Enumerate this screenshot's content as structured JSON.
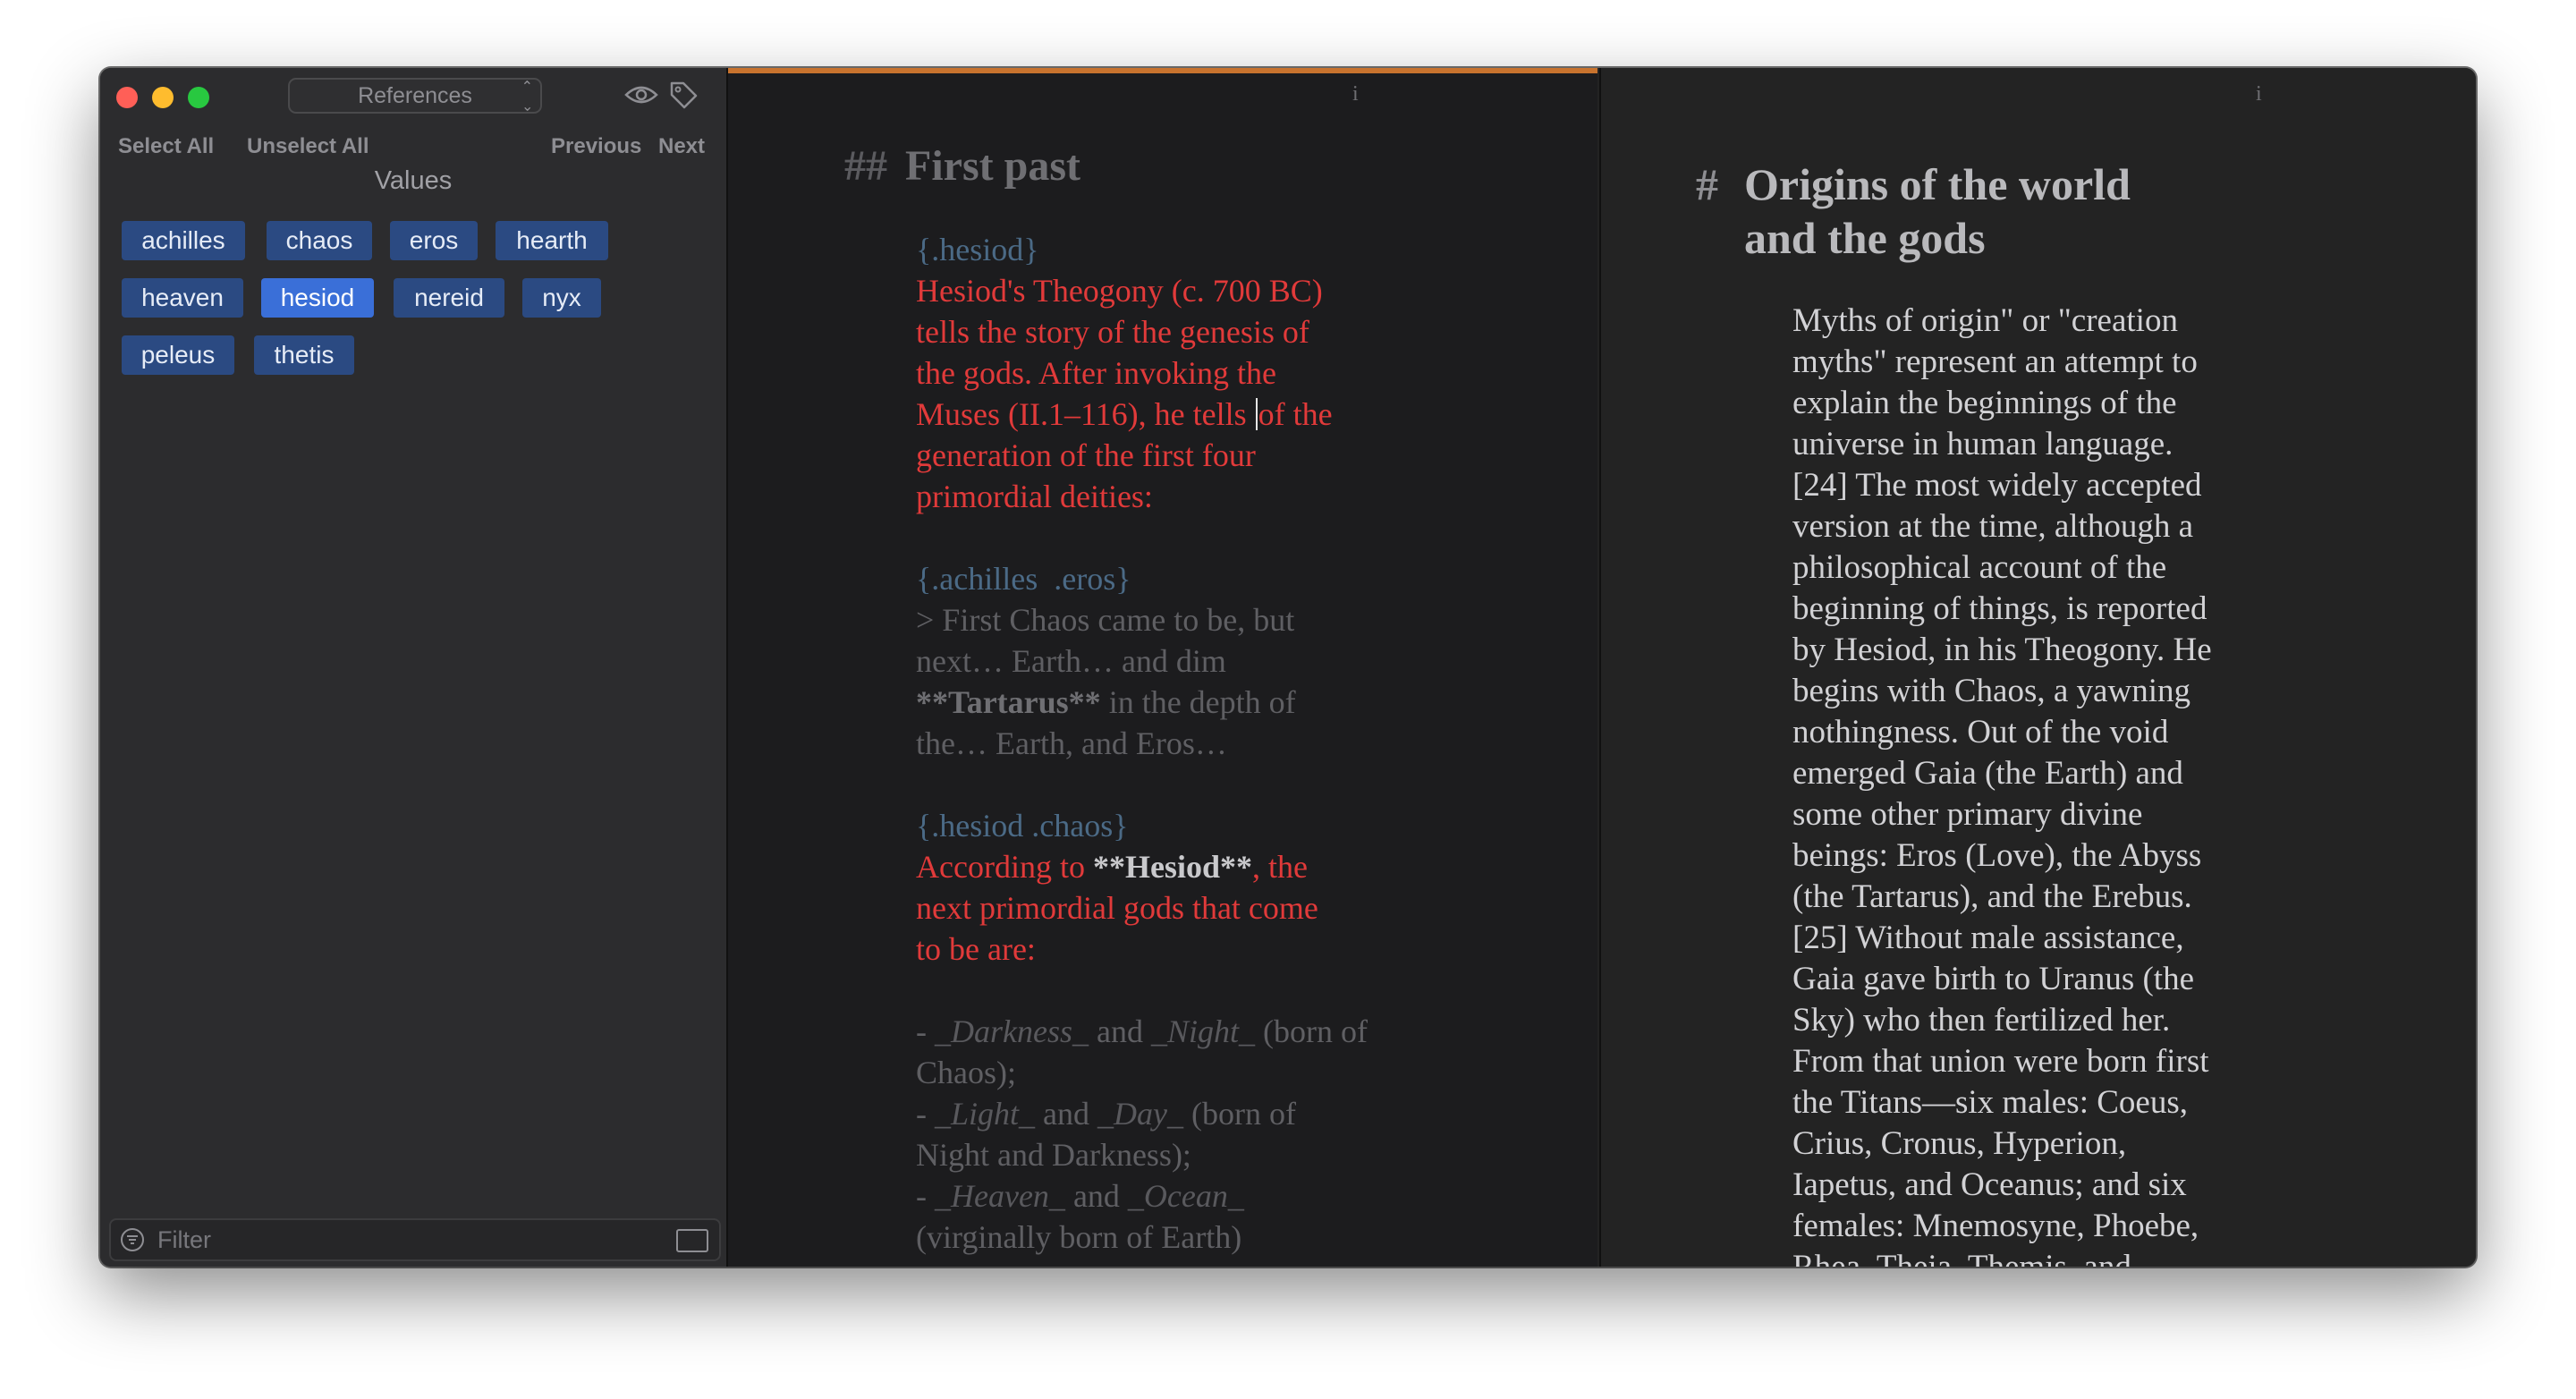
{
  "sidebar": {
    "popup_label": "References",
    "popup_icon": "chevron-updown-icon",
    "eye_icon": "eye-icon",
    "tag_icon": "tag-icon",
    "select_all": "Select All",
    "unselect_all": "Unselect All",
    "previous": "Previous",
    "next": "Next",
    "values_header": "Values",
    "chips": [
      {
        "label": "achilles",
        "selected": false
      },
      {
        "label": "chaos",
        "selected": false
      },
      {
        "label": "eros",
        "selected": false
      },
      {
        "label": "hearth",
        "selected": false
      },
      {
        "label": "heaven",
        "selected": false
      },
      {
        "label": "hesiod",
        "selected": true
      },
      {
        "label": "nereid",
        "selected": false
      },
      {
        "label": "nyx",
        "selected": false
      },
      {
        "label": "peleus",
        "selected": false
      },
      {
        "label": "thetis",
        "selected": false
      }
    ],
    "filter_placeholder": "Filter"
  },
  "editor": {
    "info": "i",
    "heading_marker": "##",
    "heading": "First past",
    "block1": {
      "attr": "{.hesiod}",
      "lines": [
        "Hesiod's Theogony (c. 700 BC)",
        "tells the story of the genesis of",
        "the gods. After invoking the"
      ],
      "line4a": "Muses (II.1–116), he tells ",
      "line4b": "of the",
      "lines2": [
        "generation of the first four",
        "primordial deities:"
      ]
    },
    "block2": {
      "attr_a": "{.achilles",
      "attr_b": ".eros}",
      "line1": "> First Chaos came to be, but",
      "line2": "next… Earth… and dim",
      "line3_bold": "**Tartarus**",
      "line3_rest": " in the depth of",
      "line4": "the… Earth, and Eros…"
    },
    "block3": {
      "attr": "{.hesiod .chaos}",
      "line1_a": "According to ",
      "line1_bold": "**Hesiod**",
      "line1_b": ", the",
      "line2": "next primordial gods that come",
      "line3": "to be are:"
    },
    "block4": {
      "l1_dash": "- ",
      "l1_i1": "_Darkness_",
      "l1_and": " and ",
      "l1_i2": "_Night_",
      "l1_rest": " (born of",
      "l2": "Chaos);",
      "l3_dash": "- ",
      "l3_i1": "_Light_",
      "l3_and": " and ",
      "l3_i2": "_Day_",
      "l3_rest": " (born of",
      "l4": "Night and Darkness);",
      "l5_dash": "- ",
      "l5_i1": "_Heaven_",
      "l5_and": " and ",
      "l5_i2": "_Ocean_",
      "l6": "(virginally born of Earth)"
    },
    "accent_color": "#c8732e"
  },
  "preview": {
    "info": "i",
    "heading_marker": "#",
    "heading_lines": [
      "Origins of the world",
      "and the gods"
    ],
    "lines": [
      "Myths of origin\" or \"creation",
      "myths\" represent an attempt to",
      "explain the beginnings of the",
      "universe in human language.",
      "[24] The most widely accepted",
      "version at the time, although a",
      "philosophical account of the",
      "beginning of things, is reported",
      "by Hesiod, in his Theogony. He",
      "begins with Chaos, a yawning",
      "nothingness. Out of the void",
      "emerged Gaia (the Earth) and",
      "some other primary divine",
      "beings: Eros (Love), the Abyss",
      "(the Tartarus), and the Erebus.",
      "[25] Without male assistance,",
      "Gaia gave birth to Uranus (the",
      "Sky) who then fertilized her.",
      "From that union were born first",
      "the Titans—six males: Coeus,",
      "Crius, Cronus, Hyperion,",
      "Iapetus, and Oceanus; and six",
      "females: Mnemosyne, Phoebe,",
      "Rhea, Theia, Themis, and"
    ]
  }
}
